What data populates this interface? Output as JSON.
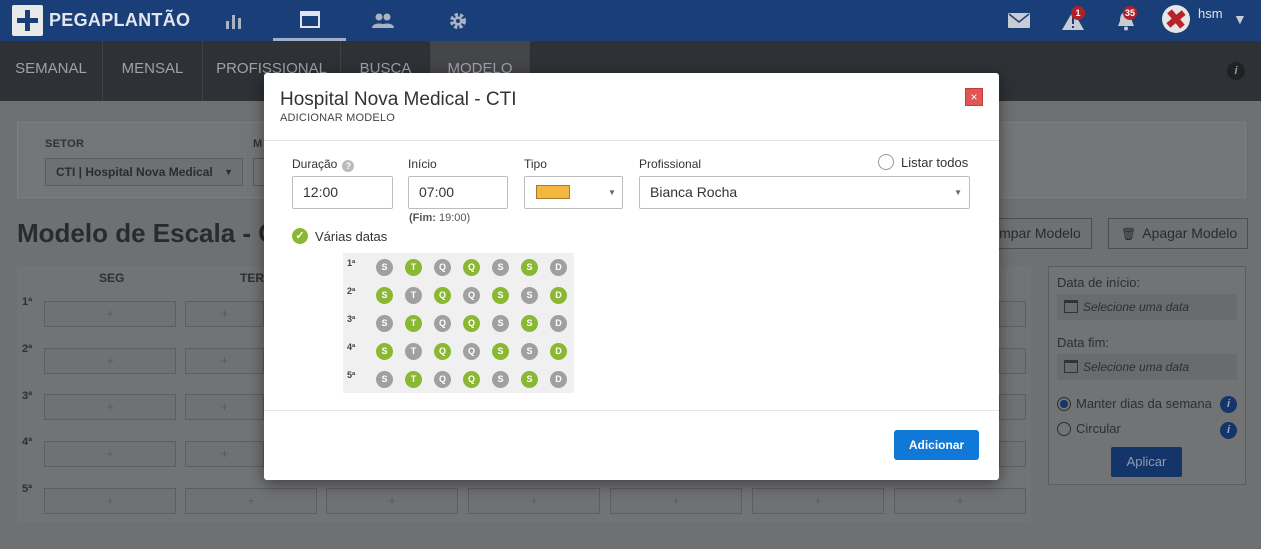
{
  "app": {
    "brand": "PEGAPLANTÃO",
    "nav_icons": [
      {
        "icon": "bar-chart-icon",
        "glyph": "▮▮"
      },
      {
        "icon": "calendar-window-icon",
        "glyph": "▭"
      },
      {
        "icon": "users-icon",
        "glyph": "👥"
      },
      {
        "icon": "gear-icon",
        "glyph": "⚙"
      }
    ],
    "alerts_badge": "1",
    "notifications_badge": "35",
    "username": "hsm"
  },
  "subtabs": [
    "SEMANAL",
    "MENSAL",
    "PROFISSIONAL",
    "BUSCA",
    "MODELO"
  ],
  "active_subtab": "MODELO",
  "background": {
    "setor_label": "SETOR",
    "m_label": "M",
    "setor_value": "CTI | Hospital Nova Medical",
    "page_title": "Modelo de Escala - CT",
    "limpar_button": "impar Modelo",
    "apagar_button": "Apagar Modelo",
    "grid_headers": [
      "SEG",
      "TER"
    ],
    "row_labels": [
      "1ª",
      "2ª",
      "3ª",
      "4ª",
      "5ª"
    ],
    "cell_plus": "+",
    "side": {
      "start_label": "Data de início:",
      "start_placeholder": "Selecione uma data",
      "end_label": "Data fim:",
      "end_placeholder": "Selecione uma data",
      "option_keep": "Manter dias da semana",
      "option_circular": "Circular",
      "apply": "Aplicar"
    }
  },
  "modal": {
    "title": "Hospital Nova Medical - CTI",
    "subtitle": "ADICIONAR MODELO",
    "close": "×",
    "duracao_label": "Duração",
    "duracao_value": "12:00",
    "inicio_label": "Início",
    "inicio_value": "07:00",
    "fim_prefix": "(Fim:",
    "fim_value": "19:00)",
    "tipo_label": "Tipo",
    "tipo_color": "#f3b63e",
    "profissional_label": "Profissional",
    "profissional_value": "Bianca Rocha",
    "listar_todos": "Listar todos",
    "varias_datas": "Várias datas",
    "weeks": [
      {
        "label": "1ª",
        "days": [
          {
            "l": "S",
            "on": false
          },
          {
            "l": "T",
            "on": true
          },
          {
            "l": "Q",
            "on": false
          },
          {
            "l": "Q",
            "on": true
          },
          {
            "l": "S",
            "on": false
          },
          {
            "l": "S",
            "on": true
          },
          {
            "l": "D",
            "on": false
          }
        ]
      },
      {
        "label": "2ª",
        "days": [
          {
            "l": "S",
            "on": true
          },
          {
            "l": "T",
            "on": false
          },
          {
            "l": "Q",
            "on": true
          },
          {
            "l": "Q",
            "on": false
          },
          {
            "l": "S",
            "on": true
          },
          {
            "l": "S",
            "on": false
          },
          {
            "l": "D",
            "on": true
          }
        ]
      },
      {
        "label": "3ª",
        "days": [
          {
            "l": "S",
            "on": false
          },
          {
            "l": "T",
            "on": true
          },
          {
            "l": "Q",
            "on": false
          },
          {
            "l": "Q",
            "on": true
          },
          {
            "l": "S",
            "on": false
          },
          {
            "l": "S",
            "on": true
          },
          {
            "l": "D",
            "on": false
          }
        ]
      },
      {
        "label": "4ª",
        "days": [
          {
            "l": "S",
            "on": true
          },
          {
            "l": "T",
            "on": false
          },
          {
            "l": "Q",
            "on": true
          },
          {
            "l": "Q",
            "on": false
          },
          {
            "l": "S",
            "on": true
          },
          {
            "l": "S",
            "on": false
          },
          {
            "l": "D",
            "on": true
          }
        ]
      },
      {
        "label": "5ª",
        "days": [
          {
            "l": "S",
            "on": false
          },
          {
            "l": "T",
            "on": true
          },
          {
            "l": "Q",
            "on": false
          },
          {
            "l": "Q",
            "on": true
          },
          {
            "l": "S",
            "on": false
          },
          {
            "l": "S",
            "on": true
          },
          {
            "l": "D",
            "on": false
          }
        ]
      }
    ],
    "add_button": "Adicionar"
  }
}
